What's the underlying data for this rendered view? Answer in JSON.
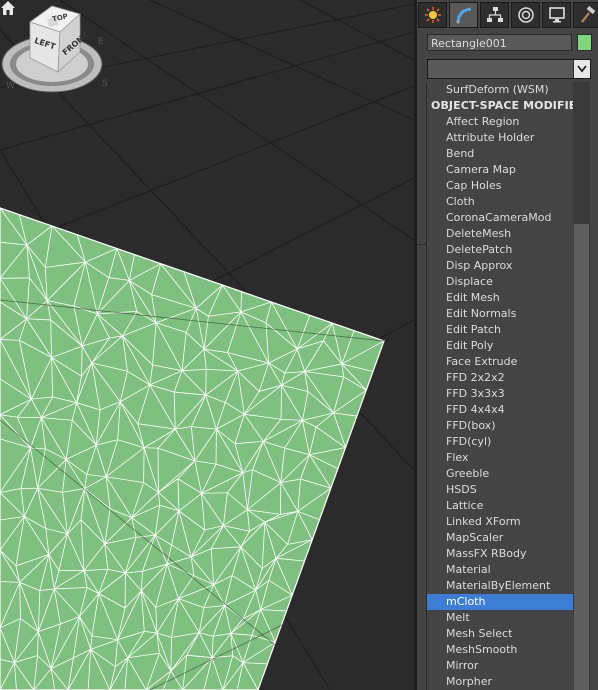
{
  "object_name": "Rectangle001",
  "object_color": "#7ed67e",
  "viewcube": {
    "top": "TOP",
    "left": "LEFT",
    "front": "FRONT"
  },
  "command_tabs": [
    {
      "name": "create-tab",
      "icon": "sun-icon"
    },
    {
      "name": "modify-tab",
      "icon": "curve-icon"
    },
    {
      "name": "hierarchy-tab",
      "icon": "hierarchy-icon"
    },
    {
      "name": "motion-tab",
      "icon": "motion-icon"
    },
    {
      "name": "display-tab",
      "icon": "monitor-icon"
    },
    {
      "name": "utilities-tab",
      "icon": "hammer-icon"
    }
  ],
  "modifier_list": {
    "top_item": "SurfDeform (WSM)",
    "section_header": "OBJECT-SPACE MODIFIERS",
    "items": [
      "Affect Region",
      "Attribute Holder",
      "Bend",
      "Camera Map",
      "Cap Holes",
      "Cloth",
      "CoronaCameraMod",
      "DeleteMesh",
      "DeletePatch",
      "Disp Approx",
      "Displace",
      "Edit Mesh",
      "Edit Normals",
      "Edit Patch",
      "Edit Poly",
      "Face Extrude",
      "FFD 2x2x2",
      "FFD 3x3x3",
      "FFD 4x4x4",
      "FFD(box)",
      "FFD(cyl)",
      "Flex",
      "Greeble",
      "HSDS",
      "Lattice",
      "Linked XForm",
      "MapScaler",
      "MassFX RBody",
      "Material",
      "MaterialByElement",
      "mCloth",
      "Melt",
      "Mesh Select",
      "MeshSmooth",
      "Mirror",
      "Morpher"
    ],
    "selected": "mCloth",
    "selection_color": "#3d7ed4"
  }
}
